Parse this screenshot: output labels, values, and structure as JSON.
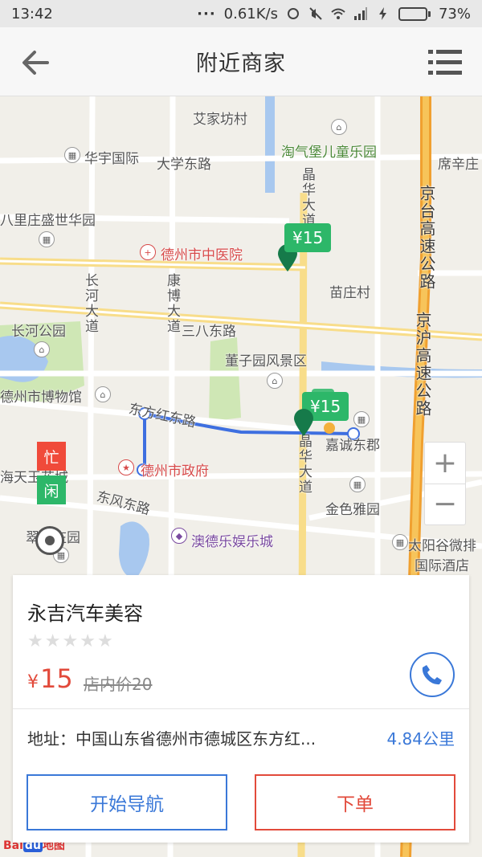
{
  "status_bar": {
    "time": "13:42",
    "speed": "0.61K/s",
    "battery": "73%",
    "battery_level": 0.73
  },
  "header": {
    "title": "附近商家"
  },
  "map": {
    "labels": {
      "aijiafangcun": "艾家坊村",
      "taoqibao": "淘气堡儿童乐园",
      "huayu": "华宇国际",
      "daxuedonglu": "大学东路",
      "bilizhuang": "八里庄盛世华园",
      "jinghua1": "晶华大道",
      "jinghua2": "晶华大道",
      "zhongyiyuan": "德州市中医院",
      "changhe_dadao": "长河大道",
      "kangbo_dadao": "康博大道",
      "miaozhuang": "苗庄村",
      "changhe_park": "长河公园",
      "sanba": "三八东路",
      "dongziyuan": "董子园风景区",
      "bowuguan": "德州市博物馆",
      "dongfanghong": "东方红东路",
      "jiacheng": "嘉诚东郡",
      "zhengfu": "德州市政府",
      "haitian": "海天玉花城",
      "dongfeng": "东风东路",
      "jinse": "金色雅园",
      "cuiliu": "翠柳庄园",
      "aode": "澳德乐娱乐城",
      "taiyanggu": "太阳谷微排",
      "guoji": "国际酒店",
      "xixinzhuang": "席辛庄",
      "jingtai": "京台高速公路",
      "jinghu": "京沪高速公路"
    },
    "price_tags": [
      "¥15",
      "¥15"
    ],
    "status_tags": {
      "busy": "忙",
      "idle": "闲"
    },
    "zoom": {
      "in": "+",
      "out": "−"
    },
    "logo": {
      "bai": "Bai",
      "du": "du",
      "suffix": "地图"
    }
  },
  "shop": {
    "name": "永吉汽车美容",
    "rating": 0,
    "rating_max": 5,
    "price_symbol": "¥",
    "price": "15",
    "original_price": "店内价20",
    "address_label": "地址：",
    "address": "中国山东省德州市德城区东方红...",
    "distance": "4.84公里",
    "nav_button": "开始导航",
    "order_button": "下单"
  },
  "colors": {
    "accent_blue": "#3a78d8",
    "accent_red": "#e24a3b",
    "pin_green": "#2db769"
  }
}
